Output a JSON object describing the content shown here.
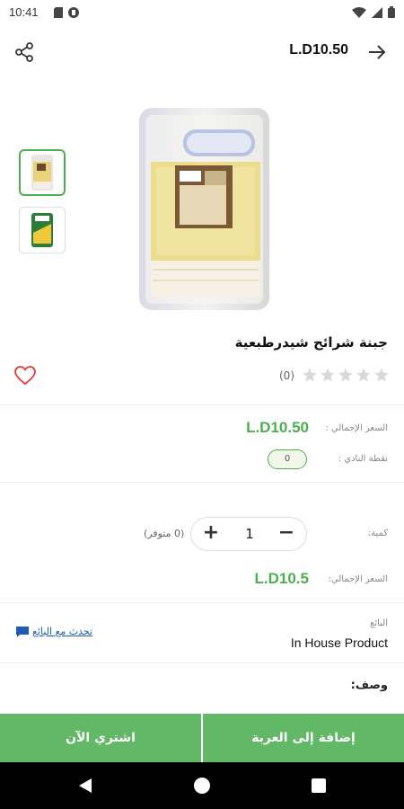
{
  "status_bar": {
    "time": "10:41"
  },
  "header": {
    "price": "L.D10.50",
    "icons": [
      "share-icon",
      "arrow-right-icon"
    ]
  },
  "product": {
    "title": "جبنة شرائح شيدرطبعية",
    "rating_count": "(0)",
    "rating_stars": 0,
    "rating_max": 5
  },
  "pricing": {
    "total_price_label": "السعر الإجمالي :",
    "total_price": "L.D10.50",
    "club_points_label": "نقطة النادي :",
    "club_points": "0"
  },
  "quantity": {
    "label": "كمية:",
    "value": "1",
    "available": "(0 متوفر)"
  },
  "order_total": {
    "label": "السعر الإجمالي:",
    "value": "L.D10.5"
  },
  "seller": {
    "label": "البائع",
    "name": "In House Product",
    "chat_label": "تحدث مع البائع"
  },
  "description": {
    "label": "وصف:"
  },
  "actions": {
    "buy_now": "اشتري الآن",
    "add_to_cart": "إضافة إلى العربة"
  },
  "colors": {
    "accent": "#4caf50",
    "button": "#63b868",
    "link": "#1e5bb5",
    "wishlist": "#e53935"
  }
}
